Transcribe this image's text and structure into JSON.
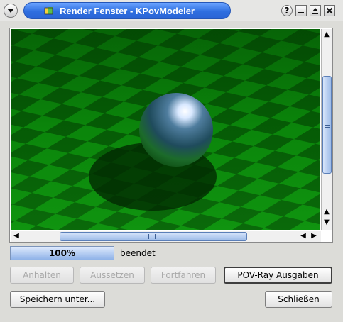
{
  "window": {
    "title": "Render Fenster - KPovModeler",
    "help_label": "?"
  },
  "progress": {
    "value": 1.0,
    "label": "100%"
  },
  "status": {
    "text": "beendet"
  },
  "buttons": {
    "stop": "Anhalten",
    "suspend": "Aussetzen",
    "resume": "Fortfahren",
    "povray_output": "POV-Ray Ausgaben",
    "save_as": "Speichern unter...",
    "close": "Schließen"
  },
  "colors": {
    "accent": "#2f6fe0",
    "checker_light": "#0fa00f",
    "checker_dark": "#076007"
  }
}
